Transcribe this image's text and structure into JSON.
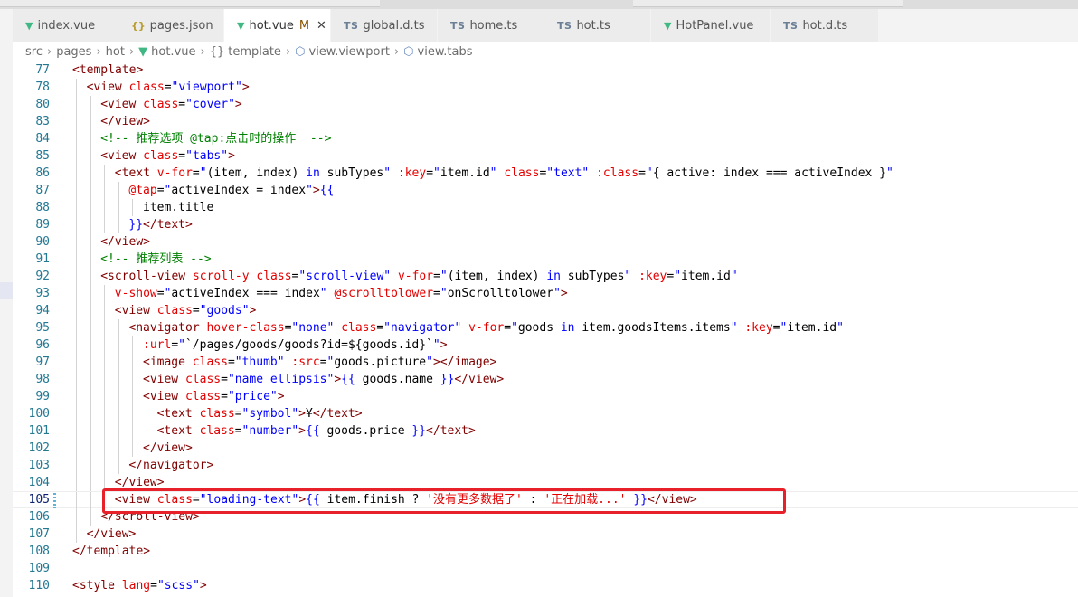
{
  "tabs": [
    {
      "label": "index.vue",
      "icon": "vue-icon",
      "active": false,
      "modified": "",
      "closable": false
    },
    {
      "label": "pages.json",
      "icon": "json-icon",
      "active": false,
      "modified": "",
      "closable": false
    },
    {
      "label": "hot.vue",
      "icon": "vue-icon",
      "active": true,
      "modified": "M",
      "closable": true
    },
    {
      "label": "global.d.ts",
      "icon": "ts-icon",
      "active": false,
      "modified": "",
      "closable": false
    },
    {
      "label": "home.ts",
      "icon": "ts-icon",
      "active": false,
      "modified": "",
      "closable": false
    },
    {
      "label": "hot.ts",
      "icon": "ts-icon",
      "active": false,
      "modified": "",
      "closable": false
    },
    {
      "label": "HotPanel.vue",
      "icon": "vue-icon",
      "active": false,
      "modified": "",
      "closable": false
    },
    {
      "label": "hot.d.ts",
      "icon": "ts-icon",
      "active": false,
      "modified": "",
      "closable": false
    }
  ],
  "icon_glyphs": {
    "vue": "▼",
    "ts": "TS",
    "json": "{}",
    "close": "✕"
  },
  "breadcrumb": [
    "src",
    "pages",
    "hot",
    "hot.vue",
    "template",
    "view.viewport",
    "view.tabs"
  ],
  "breadcrumb_icons": [
    "",
    "",
    "",
    "vue-icon",
    "braces-icon",
    "cube-icon",
    "cube-icon"
  ],
  "breadcrumb_sep": "›",
  "current_line": "105",
  "colors": {
    "tag": "#800000",
    "attr": "#e50000",
    "string": "#0000ff",
    "comment": "#008000",
    "line_number": "#237893",
    "highlight_box": "#e8202a"
  },
  "code_lines": [
    {
      "n": "77",
      "indent": 0,
      "tokens": [
        [
          "t",
          "<template>"
        ]
      ]
    },
    {
      "n": "78",
      "indent": 1,
      "tokens": [
        [
          "t",
          "<view "
        ],
        [
          "a",
          "class"
        ],
        [
          "p",
          "="
        ],
        [
          "s",
          "\"viewport\""
        ],
        [
          "t",
          ">"
        ]
      ]
    },
    {
      "n": "80",
      "indent": 2,
      "tokens": [
        [
          "t",
          "<view "
        ],
        [
          "a",
          "class"
        ],
        [
          "p",
          "="
        ],
        [
          "s",
          "\"cover\""
        ],
        [
          "t",
          ">"
        ]
      ]
    },
    {
      "n": "83",
      "indent": 2,
      "tokens": [
        [
          "t",
          "</view>"
        ]
      ]
    },
    {
      "n": "84",
      "indent": 2,
      "tokens": [
        [
          "c",
          "<!-- 推荐选项 @tap:点击时的操作  -->"
        ]
      ]
    },
    {
      "n": "85",
      "indent": 2,
      "tokens": [
        [
          "t",
          "<view "
        ],
        [
          "a",
          "class"
        ],
        [
          "p",
          "="
        ],
        [
          "s",
          "\"tabs\""
        ],
        [
          "t",
          ">"
        ]
      ]
    },
    {
      "n": "86",
      "indent": 3,
      "tokens": [
        [
          "t",
          "<text "
        ],
        [
          "a",
          "v-for"
        ],
        [
          "p",
          "="
        ],
        [
          "s",
          "\""
        ],
        [
          "x",
          "(item, index) "
        ],
        [
          "k",
          "in"
        ],
        [
          "x",
          " subTypes"
        ],
        [
          "s",
          "\""
        ],
        [
          "t",
          " "
        ],
        [
          "a",
          ":key"
        ],
        [
          "p",
          "="
        ],
        [
          "s",
          "\""
        ],
        [
          "x",
          "item.id"
        ],
        [
          "s",
          "\""
        ],
        [
          "t",
          " "
        ],
        [
          "a",
          "class"
        ],
        [
          "p",
          "="
        ],
        [
          "s",
          "\"text\""
        ],
        [
          "t",
          " "
        ],
        [
          "a",
          ":class"
        ],
        [
          "p",
          "="
        ],
        [
          "s",
          "\""
        ],
        [
          "x",
          "{ active: index === activeIndex }"
        ],
        [
          "s",
          "\""
        ]
      ]
    },
    {
      "n": "87",
      "indent": 4,
      "tokens": [
        [
          "a",
          "@tap"
        ],
        [
          "p",
          "="
        ],
        [
          "s",
          "\""
        ],
        [
          "x",
          "activeIndex = index"
        ],
        [
          "s",
          "\""
        ],
        [
          "t",
          ">"
        ],
        [
          "s",
          "{{"
        ]
      ]
    },
    {
      "n": "88",
      "indent": 5,
      "tokens": [
        [
          "x",
          "item.title"
        ]
      ]
    },
    {
      "n": "89",
      "indent": 4,
      "tokens": [
        [
          "s",
          "}}"
        ],
        [
          "t",
          "</text>"
        ]
      ]
    },
    {
      "n": "90",
      "indent": 2,
      "tokens": [
        [
          "t",
          "</view>"
        ]
      ]
    },
    {
      "n": "91",
      "indent": 2,
      "tokens": [
        [
          "c",
          "<!-- 推荐列表 -->"
        ]
      ]
    },
    {
      "n": "92",
      "indent": 2,
      "tokens": [
        [
          "t",
          "<scroll-view "
        ],
        [
          "a",
          "scroll-y"
        ],
        [
          "t",
          " "
        ],
        [
          "a",
          "class"
        ],
        [
          "p",
          "="
        ],
        [
          "s",
          "\"scroll-view\""
        ],
        [
          "t",
          " "
        ],
        [
          "a",
          "v-for"
        ],
        [
          "p",
          "="
        ],
        [
          "s",
          "\""
        ],
        [
          "x",
          "(item, index) "
        ],
        [
          "k",
          "in"
        ],
        [
          "x",
          " subTypes"
        ],
        [
          "s",
          "\""
        ],
        [
          "t",
          " "
        ],
        [
          "a",
          ":key"
        ],
        [
          "p",
          "="
        ],
        [
          "s",
          "\""
        ],
        [
          "x",
          "item.id"
        ],
        [
          "s",
          "\""
        ]
      ]
    },
    {
      "n": "93",
      "indent": 3,
      "tokens": [
        [
          "a",
          "v-show"
        ],
        [
          "p",
          "="
        ],
        [
          "s",
          "\""
        ],
        [
          "x",
          "activeIndex === index"
        ],
        [
          "s",
          "\""
        ],
        [
          "t",
          " "
        ],
        [
          "a",
          "@scrolltolower"
        ],
        [
          "p",
          "="
        ],
        [
          "s",
          "\""
        ],
        [
          "x",
          "onScrolltolower"
        ],
        [
          "s",
          "\""
        ],
        [
          "t",
          ">"
        ]
      ]
    },
    {
      "n": "94",
      "indent": 3,
      "tokens": [
        [
          "t",
          "<view "
        ],
        [
          "a",
          "class"
        ],
        [
          "p",
          "="
        ],
        [
          "s",
          "\"goods\""
        ],
        [
          "t",
          ">"
        ]
      ]
    },
    {
      "n": "95",
      "indent": 4,
      "tokens": [
        [
          "t",
          "<navigator "
        ],
        [
          "a",
          "hover-class"
        ],
        [
          "p",
          "="
        ],
        [
          "s",
          "\"none\""
        ],
        [
          "t",
          " "
        ],
        [
          "a",
          "class"
        ],
        [
          "p",
          "="
        ],
        [
          "s",
          "\"navigator\""
        ],
        [
          "t",
          " "
        ],
        [
          "a",
          "v-for"
        ],
        [
          "p",
          "="
        ],
        [
          "s",
          "\""
        ],
        [
          "x",
          "goods "
        ],
        [
          "k",
          "in"
        ],
        [
          "x",
          " item.goodsItems.items"
        ],
        [
          "s",
          "\""
        ],
        [
          "t",
          " "
        ],
        [
          "a",
          ":key"
        ],
        [
          "p",
          "="
        ],
        [
          "s",
          "\""
        ],
        [
          "x",
          "item.id"
        ],
        [
          "s",
          "\""
        ]
      ]
    },
    {
      "n": "96",
      "indent": 5,
      "tokens": [
        [
          "a",
          ":url"
        ],
        [
          "p",
          "="
        ],
        [
          "s",
          "\""
        ],
        [
          "x",
          "`/pages/goods/goods?id=${goods.id}`"
        ],
        [
          "s",
          "\""
        ],
        [
          "t",
          ">"
        ]
      ]
    },
    {
      "n": "97",
      "indent": 5,
      "tokens": [
        [
          "t",
          "<image "
        ],
        [
          "a",
          "class"
        ],
        [
          "p",
          "="
        ],
        [
          "s",
          "\"thumb\""
        ],
        [
          "t",
          " "
        ],
        [
          "a",
          ":src"
        ],
        [
          "p",
          "="
        ],
        [
          "s",
          "\""
        ],
        [
          "x",
          "goods.picture"
        ],
        [
          "s",
          "\""
        ],
        [
          "t",
          "></image>"
        ]
      ]
    },
    {
      "n": "98",
      "indent": 5,
      "tokens": [
        [
          "t",
          "<view "
        ],
        [
          "a",
          "class"
        ],
        [
          "p",
          "="
        ],
        [
          "s",
          "\"name ellipsis\""
        ],
        [
          "t",
          ">"
        ],
        [
          "s",
          "{{"
        ],
        [
          "x",
          " goods.name "
        ],
        [
          "s",
          "}}"
        ],
        [
          "t",
          "</view>"
        ]
      ]
    },
    {
      "n": "99",
      "indent": 5,
      "tokens": [
        [
          "t",
          "<view "
        ],
        [
          "a",
          "class"
        ],
        [
          "p",
          "="
        ],
        [
          "s",
          "\"price\""
        ],
        [
          "t",
          ">"
        ]
      ]
    },
    {
      "n": "100",
      "indent": 6,
      "tokens": [
        [
          "t",
          "<text "
        ],
        [
          "a",
          "class"
        ],
        [
          "p",
          "="
        ],
        [
          "s",
          "\"symbol\""
        ],
        [
          "t",
          ">"
        ],
        [
          "x",
          "¥"
        ],
        [
          "t",
          "</text>"
        ]
      ]
    },
    {
      "n": "101",
      "indent": 6,
      "tokens": [
        [
          "t",
          "<text "
        ],
        [
          "a",
          "class"
        ],
        [
          "p",
          "="
        ],
        [
          "s",
          "\"number\""
        ],
        [
          "t",
          ">"
        ],
        [
          "s",
          "{{"
        ],
        [
          "x",
          " goods.price "
        ],
        [
          "s",
          "}}"
        ],
        [
          "t",
          "</text>"
        ]
      ]
    },
    {
      "n": "102",
      "indent": 5,
      "tokens": [
        [
          "t",
          "</view>"
        ]
      ]
    },
    {
      "n": "103",
      "indent": 4,
      "tokens": [
        [
          "t",
          "</navigator>"
        ]
      ]
    },
    {
      "n": "104",
      "indent": 3,
      "tokens": [
        [
          "t",
          "</view>"
        ]
      ]
    },
    {
      "n": "105",
      "indent": 3,
      "tokens": [
        [
          "t",
          "<view "
        ],
        [
          "a",
          "class"
        ],
        [
          "p",
          "="
        ],
        [
          "s",
          "\"loading-text\""
        ],
        [
          "t",
          ">"
        ],
        [
          "s",
          "{{"
        ],
        [
          "x",
          " item.finish ? "
        ],
        [
          "a",
          "'没有更多数据了'"
        ],
        [
          "x",
          " : "
        ],
        [
          "a",
          "'正在加载...'"
        ],
        [
          "x",
          " "
        ],
        [
          "s",
          "}}"
        ],
        [
          "t",
          "</view>"
        ]
      ]
    },
    {
      "n": "106",
      "indent": 2,
      "tokens": [
        [
          "t",
          "</scroll-view>"
        ]
      ]
    },
    {
      "n": "107",
      "indent": 1,
      "tokens": [
        [
          "t",
          "</view>"
        ]
      ]
    },
    {
      "n": "108",
      "indent": 0,
      "tokens": [
        [
          "t",
          "</template>"
        ]
      ]
    },
    {
      "n": "109",
      "indent": 0,
      "tokens": []
    },
    {
      "n": "110",
      "indent": 0,
      "tokens": [
        [
          "t",
          "<style "
        ],
        [
          "a",
          "lang"
        ],
        [
          "p",
          "="
        ],
        [
          "s",
          "\"scss\""
        ],
        [
          "t",
          ">"
        ]
      ]
    }
  ]
}
